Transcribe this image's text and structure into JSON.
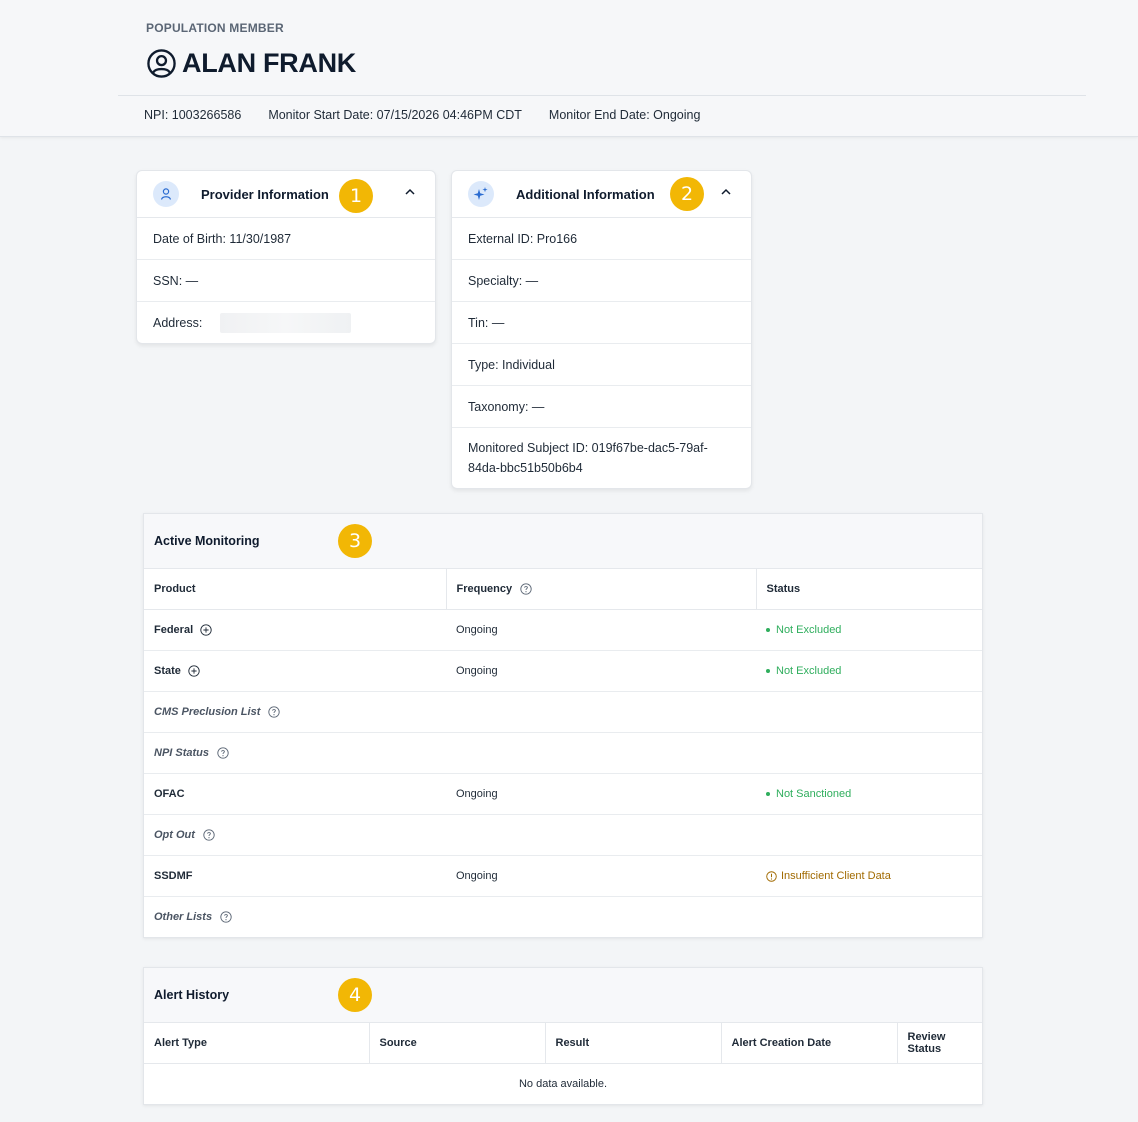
{
  "header": {
    "eyebrow": "POPULATION MEMBER",
    "name": "ALAN FRANK",
    "npi": "NPI: 1003266586",
    "start": "Monitor Start Date: 07/15/2026 04:46PM CDT",
    "end": "Monitor End Date: Ongoing"
  },
  "provider": {
    "title": "Provider Information",
    "badge": "1",
    "dob": "Date of Birth: 11/30/1987",
    "ssn": "SSN: —",
    "address": "Address:"
  },
  "additional": {
    "title": "Additional Information",
    "badge": "2",
    "external_id": "External ID: Pro166",
    "specialty": "Specialty: —",
    "tin": "Tin: —",
    "type": "Type: Individual",
    "taxonomy": "Taxonomy: —",
    "subject_id": "Monitored Subject ID: 019f67be-dac5-79af-84da-bbc51b50b6b4"
  },
  "monitoring": {
    "title": "Active Monitoring",
    "badge": "3",
    "columns": {
      "product": "Product",
      "frequency": "Frequency",
      "status": "Status"
    },
    "rows": [
      {
        "product": "Federal",
        "frequency": "Ongoing",
        "status": "Not Excluded"
      },
      {
        "product": "State",
        "frequency": "Ongoing",
        "status": "Not Excluded"
      },
      {
        "product": "CMS Preclusion List",
        "frequency": "",
        "status": ""
      },
      {
        "product": "NPI Status",
        "frequency": "",
        "status": ""
      },
      {
        "product": "OFAC",
        "frequency": "Ongoing",
        "status": "Not Sanctioned"
      },
      {
        "product": "Opt Out",
        "frequency": "",
        "status": ""
      },
      {
        "product": "SSDMF",
        "frequency": "Ongoing",
        "status": "Insufficient Client Data"
      },
      {
        "product": "Other Lists",
        "frequency": "",
        "status": ""
      }
    ]
  },
  "alerts": {
    "title": "Alert History",
    "badge": "4",
    "columns": {
      "type": "Alert Type",
      "source": "Source",
      "result": "Result",
      "created": "Alert Creation Date",
      "review": "Review Status"
    },
    "empty": "No data available."
  },
  "colors": {
    "badge": "#f2b705",
    "ok": "#2fae5d",
    "warn": "#a16a00",
    "icon_bg": "#dce9fb",
    "accent": "#2b6cd1"
  }
}
